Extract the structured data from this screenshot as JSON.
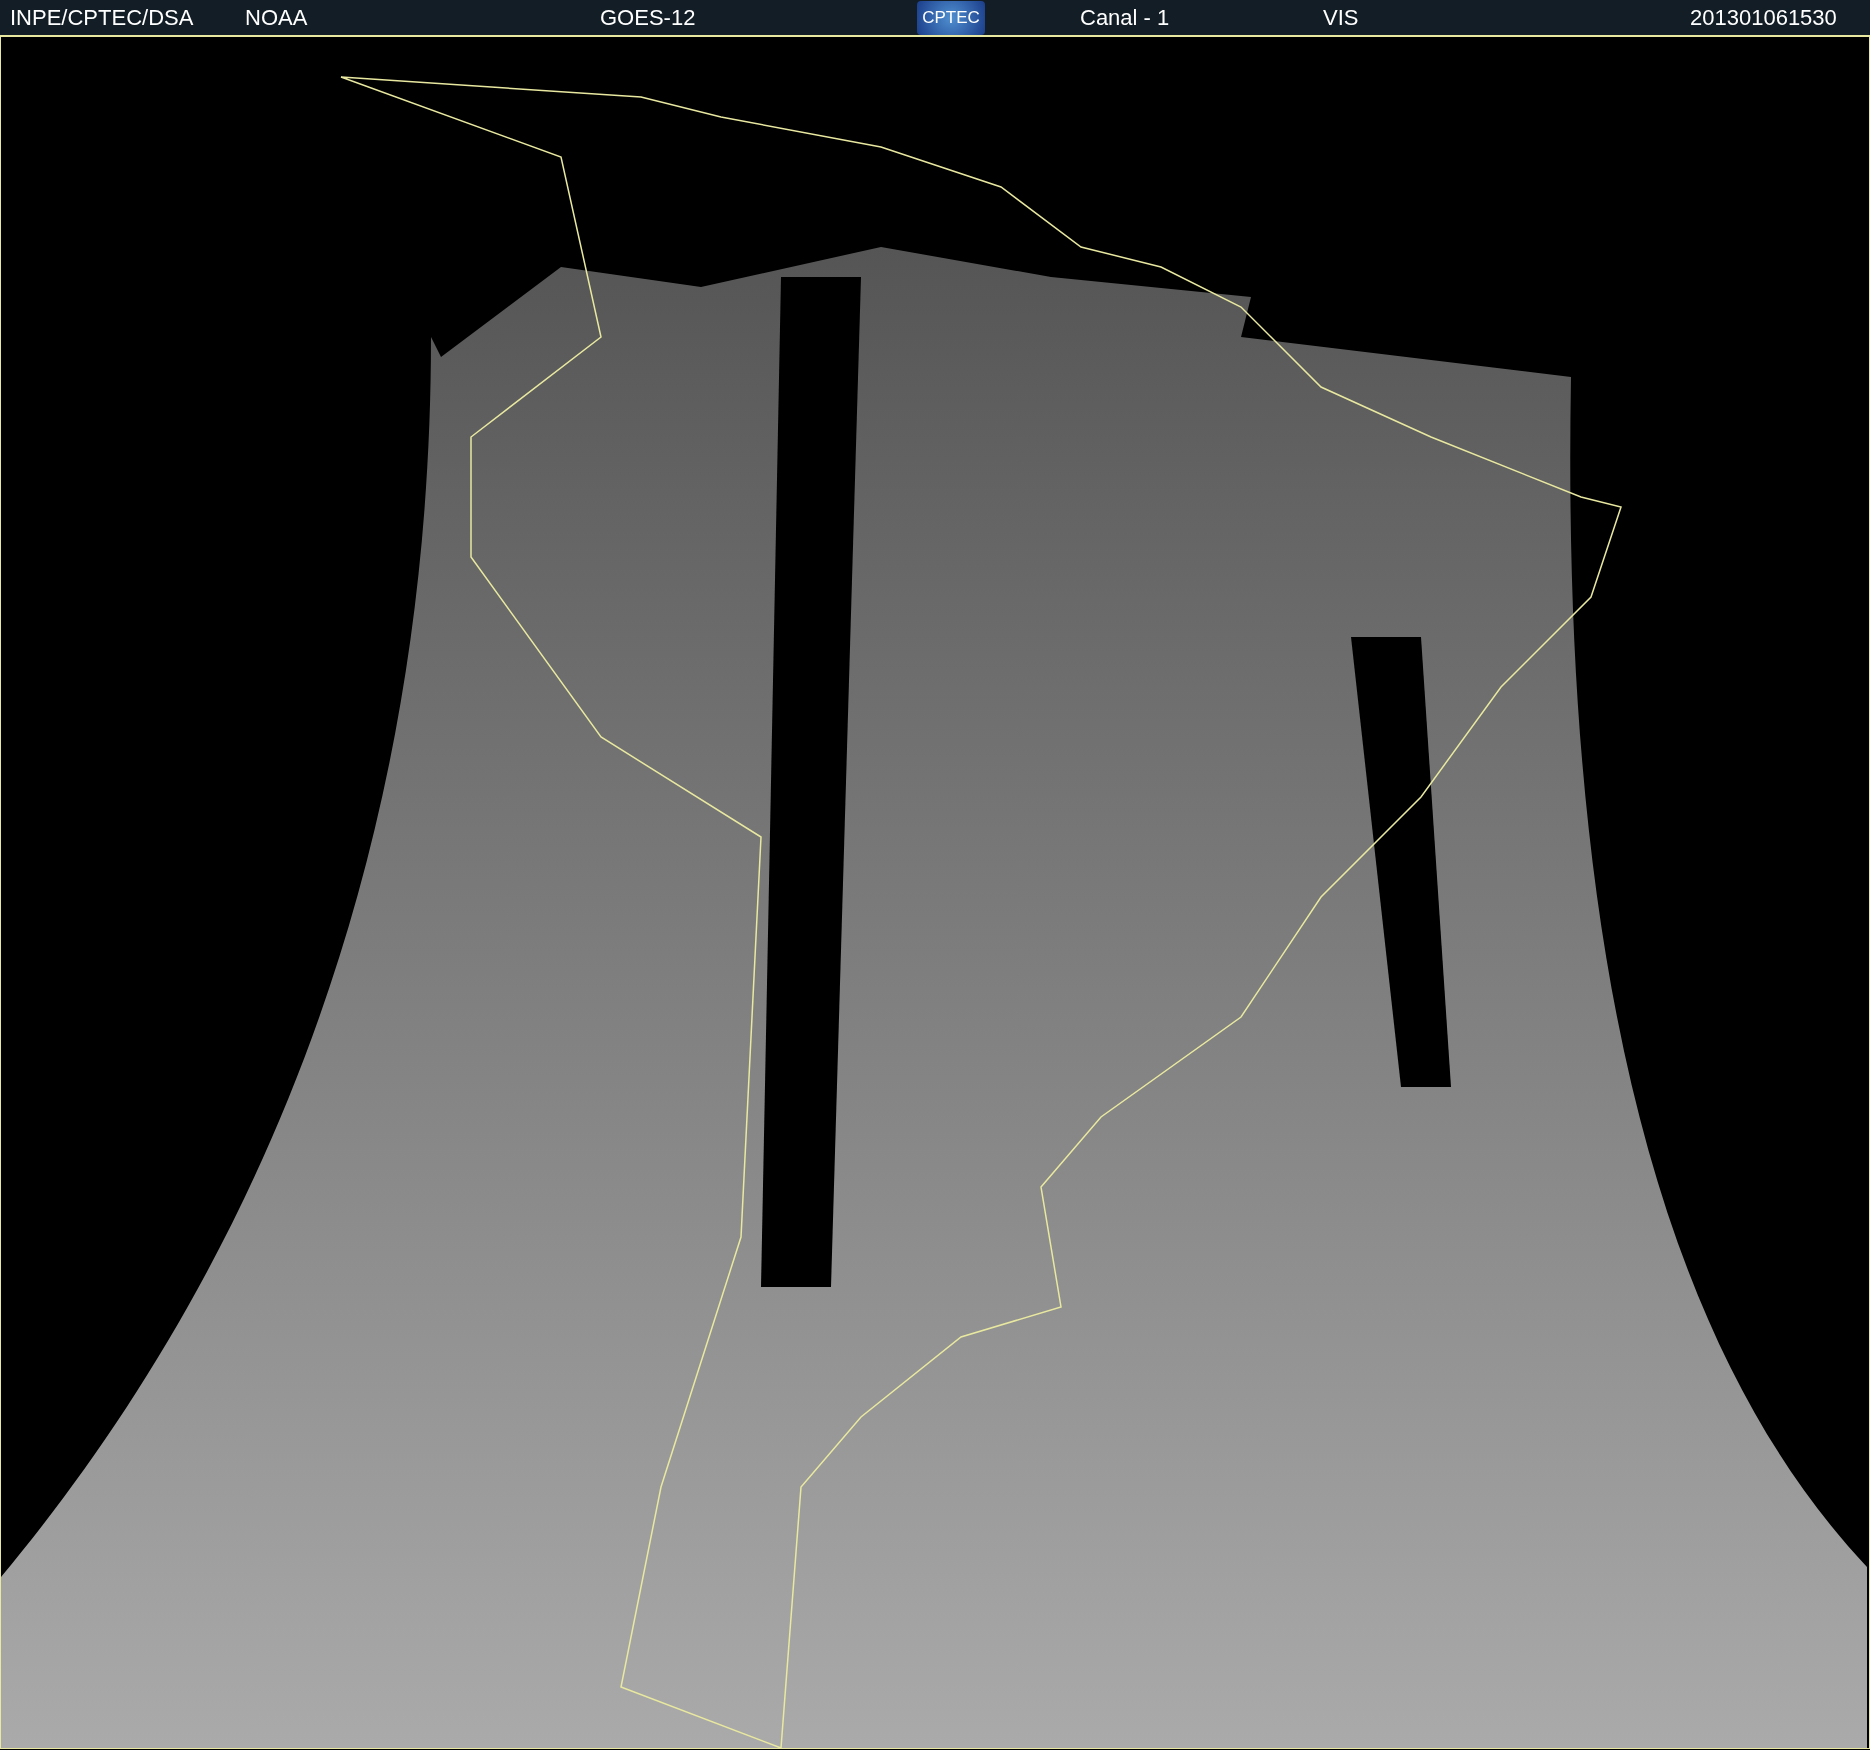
{
  "header": {
    "source": "INPE/CPTEC/DSA",
    "agency": "NOAA",
    "satellite": "GOES-12",
    "logo": "CPTEC",
    "channel": "Canal - 1",
    "band": "VIS",
    "timestamp": "201301061530"
  }
}
